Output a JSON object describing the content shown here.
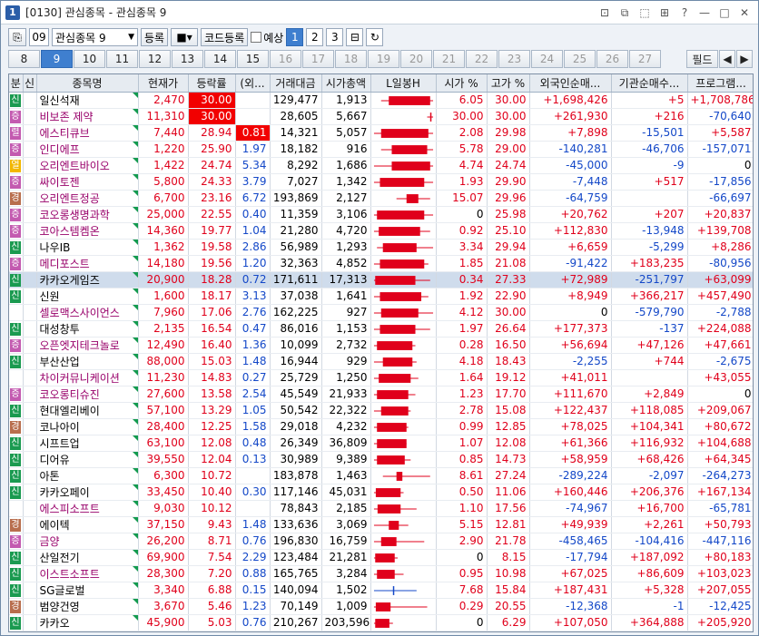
{
  "window": {
    "title": "[0130] 관심종목 - 관심종목 9"
  },
  "toolbar": {
    "group_no": "09",
    "group_name": "관심종목 9",
    "register": "등록",
    "code_register": "코드등록",
    "preview": "예상",
    "pages": [
      "1",
      "2",
      "3"
    ]
  },
  "tabs": [
    "8",
    "9",
    "10",
    "11",
    "12",
    "13",
    "14",
    "15",
    "16",
    "17",
    "18",
    "19",
    "20",
    "21",
    "22",
    "23",
    "24",
    "25",
    "26",
    "27"
  ],
  "active_tab": "9",
  "filter_label": "필드",
  "columns": [
    "분",
    "신",
    "종목명",
    "현재가",
    "등락률",
    "(외...",
    "거래대금",
    "시가총액",
    "L일봉H",
    "시가 %",
    "고가 %",
    "외국인순매...",
    "기관순매수...",
    "프로그램..."
  ],
  "colors": {
    "up": "#e0001b",
    "down": "#1448c8",
    "cat_sin": "#1a9a50",
    "cat_jeung": "#c35ab0",
    "cat_yeol": "#f2b700",
    "cat_gyeong": "#b86e4d",
    "highlight": "#f20000"
  },
  "rows": [
    {
      "cat": "신",
      "name": "일신석재",
      "price": "2,470",
      "rate": "30.00",
      "foreign": "",
      "amount": "129,477",
      "cap": "1,913",
      "open": "6.05",
      "high": "30.00",
      "fgn": "+1,698,426",
      "inst": "+5",
      "prog": "+1,708,786",
      "candle": {
        "lo": 0.12,
        "o": 0.25,
        "c": 0.95,
        "h": 1.0
      }
    },
    {
      "cat": "증",
      "name": "비보존 제약",
      "price": "11,310",
      "rate": "30.00",
      "foreign": "",
      "amount": "28,605",
      "cap": "5,667",
      "open": "30.00",
      "high": "30.00",
      "fgn": "+261,930",
      "inst": "+216",
      "prog": "-70,640",
      "candle": {
        "lo": 0.9,
        "o": 0.95,
        "c": 0.95,
        "h": 1.0
      }
    },
    {
      "cat": "렬",
      "name": "에스티큐브",
      "price": "7,440",
      "rate": "28.94",
      "foreign": "0.81",
      "amount": "14,321",
      "cap": "5,057",
      "open": "2.08",
      "high": "29.98",
      "fgn": "+7,898",
      "inst": "-15,501",
      "prog": "+5,587",
      "candle": {
        "lo": 0.0,
        "o": 0.12,
        "c": 0.92,
        "h": 1.0
      }
    },
    {
      "cat": "증",
      "name": "인디에프",
      "price": "1,220",
      "rate": "25.90",
      "foreign": "1.97",
      "amount": "18,182",
      "cap": "916",
      "open": "5.78",
      "high": "29.00",
      "fgn": "-140,281",
      "inst": "-46,706",
      "prog": "-157,071",
      "candle": {
        "lo": 0.12,
        "o": 0.3,
        "c": 0.9,
        "h": 1.0
      }
    },
    {
      "cat": "열",
      "name": "오리엔트바이오",
      "price": "1,422",
      "rate": "24.74",
      "foreign": "5.34",
      "amount": "8,292",
      "cap": "1,686",
      "open": "4.74",
      "high": "24.74",
      "fgn": "-45,000",
      "inst": "-9",
      "prog": "0",
      "candle": {
        "lo": 0.0,
        "o": 0.3,
        "c": 0.95,
        "h": 1.0
      }
    },
    {
      "cat": "증",
      "name": "싸이토젠",
      "price": "5,800",
      "rate": "24.33",
      "foreign": "3.79",
      "amount": "7,027",
      "cap": "1,342",
      "open": "1.93",
      "high": "29.90",
      "fgn": "-7,448",
      "inst": "+517",
      "prog": "-17,856",
      "candle": {
        "lo": 0.0,
        "o": 0.1,
        "c": 0.85,
        "h": 1.0
      }
    },
    {
      "cat": "경",
      "name": "오리엔트정공",
      "price": "6,700",
      "rate": "23.16",
      "foreign": "6.72",
      "amount": "193,869",
      "cap": "2,127",
      "open": "15.07",
      "high": "29.96",
      "fgn": "-64,759",
      "inst": "",
      "prog": "-66,697",
      "candle": {
        "lo": 0.38,
        "o": 0.55,
        "c": 0.75,
        "h": 0.95
      }
    },
    {
      "cat": "증",
      "name": "코오롱생명과학",
      "price": "25,000",
      "rate": "22.55",
      "foreign": "0.40",
      "amount": "11,359",
      "cap": "3,106",
      "open": "0",
      "high": "25.98",
      "fgn": "+20,762",
      "inst": "+207",
      "prog": "+20,837",
      "candle": {
        "lo": 0.0,
        "o": 0.05,
        "c": 0.85,
        "h": 1.0
      }
    },
    {
      "cat": "증",
      "name": "코아스템켐온",
      "price": "14,360",
      "rate": "19.77",
      "foreign": "1.04",
      "amount": "21,280",
      "cap": "4,720",
      "open": "0.92",
      "high": "25.10",
      "fgn": "+112,830",
      "inst": "-13,948",
      "prog": "+139,708",
      "candle": {
        "lo": 0.0,
        "o": 0.08,
        "c": 0.78,
        "h": 0.95
      }
    },
    {
      "cat": "신",
      "name": "나우IB",
      "price": "1,362",
      "rate": "19.58",
      "foreign": "2.86",
      "amount": "56,989",
      "cap": "1,293",
      "open": "3.34",
      "high": "29.94",
      "fgn": "+6,659",
      "inst": "-5,299",
      "prog": "+8,286",
      "candle": {
        "lo": 0.05,
        "o": 0.15,
        "c": 0.72,
        "h": 1.0
      }
    },
    {
      "cat": "증",
      "name": "메디포스트",
      "price": "14,180",
      "rate": "19.56",
      "foreign": "1.20",
      "amount": "32,363",
      "cap": "4,852",
      "open": "1.85",
      "high": "21.08",
      "fgn": "-91,422",
      "inst": "+183,235",
      "prog": "-80,956",
      "candle": {
        "lo": 0.0,
        "o": 0.1,
        "c": 0.85,
        "h": 0.92
      }
    },
    {
      "cat": "신",
      "name": "카카오게임즈",
      "price": "20,900",
      "rate": "18.28",
      "foreign": "0.72",
      "amount": "171,611",
      "cap": "17,313",
      "open": "0.34",
      "high": "27.33",
      "fgn": "+72,989",
      "inst": "-251,797",
      "prog": "+63,099",
      "candle": {
        "lo": 0.0,
        "o": 0.02,
        "c": 0.7,
        "h": 0.95
      },
      "selected": true
    },
    {
      "cat": "신",
      "name": "신원",
      "price": "1,600",
      "rate": "18.17",
      "foreign": "3.13",
      "amount": "37,038",
      "cap": "1,641",
      "open": "1.92",
      "high": "22.90",
      "fgn": "+8,949",
      "inst": "+366,217",
      "prog": "+457,490",
      "candle": {
        "lo": 0.0,
        "o": 0.1,
        "c": 0.8,
        "h": 0.92
      }
    },
    {
      "cat": "",
      "name": "셀로맥스사이언스",
      "price": "7,960",
      "rate": "17.06",
      "foreign": "2.76",
      "amount": "162,225",
      "cap": "927",
      "open": "4.12",
      "high": "30.00",
      "fgn": "0",
      "inst": "-579,790",
      "prog": "-2,788",
      "candle": {
        "lo": 0.0,
        "o": 0.12,
        "c": 0.75,
        "h": 1.0
      }
    },
    {
      "cat": "신",
      "name": "대성창투",
      "price": "2,135",
      "rate": "16.54",
      "foreign": "0.47",
      "amount": "86,016",
      "cap": "1,153",
      "open": "1.97",
      "high": "26.64",
      "fgn": "+177,373",
      "inst": "-137",
      "prog": "+224,088",
      "candle": {
        "lo": 0.0,
        "o": 0.1,
        "c": 0.7,
        "h": 0.95
      }
    },
    {
      "cat": "증",
      "name": "오픈엣지테크놀로",
      "price": "12,490",
      "rate": "16.40",
      "foreign": "1.36",
      "amount": "10,099",
      "cap": "2,732",
      "open": "0.28",
      "high": "16.50",
      "fgn": "+56,694",
      "inst": "+47,126",
      "prog": "+47,661",
      "candle": {
        "lo": 0.0,
        "o": 0.05,
        "c": 0.65,
        "h": 0.7
      }
    },
    {
      "cat": "신",
      "name": "부산산업",
      "price": "88,000",
      "rate": "15.03",
      "foreign": "1.48",
      "amount": "16,944",
      "cap": "929",
      "open": "4.18",
      "high": "18.43",
      "fgn": "-2,255",
      "inst": "+744",
      "prog": "-2,675",
      "candle": {
        "lo": 0.0,
        "o": 0.15,
        "c": 0.65,
        "h": 0.72
      }
    },
    {
      "cat": "",
      "name": "차이커뮤니케이션",
      "price": "11,230",
      "rate": "14.83",
      "foreign": "0.27",
      "amount": "25,729",
      "cap": "1,250",
      "open": "1.64",
      "high": "19.12",
      "fgn": "+41,011",
      "inst": "",
      "prog": "+43,055",
      "candle": {
        "lo": 0.0,
        "o": 0.08,
        "c": 0.62,
        "h": 0.75
      }
    },
    {
      "cat": "증",
      "name": "코오롱티슈진",
      "price": "27,600",
      "rate": "13.58",
      "foreign": "2.54",
      "amount": "45,549",
      "cap": "21,933",
      "open": "1.23",
      "high": "17.70",
      "fgn": "+111,670",
      "inst": "+2,849",
      "prog": "0",
      "candle": {
        "lo": 0.0,
        "o": 0.05,
        "c": 0.58,
        "h": 0.7
      }
    },
    {
      "cat": "신",
      "name": "현대엘리베이",
      "price": "57,100",
      "rate": "13.29",
      "foreign": "1.05",
      "amount": "50,542",
      "cap": "22,322",
      "open": "2.78",
      "high": "15.08",
      "fgn": "+122,437",
      "inst": "+118,085",
      "prog": "+209,067",
      "candle": {
        "lo": 0.0,
        "o": 0.12,
        "c": 0.58,
        "h": 0.62
      }
    },
    {
      "cat": "경",
      "name": "코나아이",
      "price": "28,400",
      "rate": "12.25",
      "foreign": "1.58",
      "amount": "29,018",
      "cap": "4,232",
      "open": "0.99",
      "high": "12.85",
      "fgn": "+78,025",
      "inst": "+104,341",
      "prog": "+80,672",
      "candle": {
        "lo": 0.0,
        "o": 0.05,
        "c": 0.55,
        "h": 0.58
      }
    },
    {
      "cat": "신",
      "name": "시프트업",
      "price": "63,100",
      "rate": "12.08",
      "foreign": "0.48",
      "amount": "26,349",
      "cap": "36,809",
      "open": "1.07",
      "high": "12.08",
      "fgn": "+61,366",
      "inst": "+116,932",
      "prog": "+104,688",
      "candle": {
        "lo": 0.0,
        "o": 0.05,
        "c": 0.55,
        "h": 0.55
      }
    },
    {
      "cat": "신",
      "name": "디어유",
      "price": "39,550",
      "rate": "12.04",
      "foreign": "0.13",
      "amount": "30,989",
      "cap": "9,389",
      "open": "0.85",
      "high": "14.73",
      "fgn": "+58,959",
      "inst": "+68,426",
      "prog": "+64,345",
      "candle": {
        "lo": 0.0,
        "o": 0.05,
        "c": 0.52,
        "h": 0.62
      }
    },
    {
      "cat": "신",
      "name": "아톤",
      "price": "6,300",
      "rate": "10.72",
      "foreign": "",
      "amount": "183,878",
      "cap": "1,463",
      "open": "8.61",
      "high": "27.24",
      "fgn": "-289,224",
      "inst": "-2,097",
      "prog": "-264,273",
      "candle": {
        "lo": 0.15,
        "o": 0.38,
        "c": 0.48,
        "h": 0.95
      }
    },
    {
      "cat": "신",
      "name": "카카오페이",
      "price": "33,450",
      "rate": "10.40",
      "foreign": "0.30",
      "amount": "117,146",
      "cap": "45,031",
      "open": "0.50",
      "high": "11.06",
      "fgn": "+160,446",
      "inst": "+206,376",
      "prog": "+167,134",
      "candle": {
        "lo": 0.0,
        "o": 0.03,
        "c": 0.45,
        "h": 0.5
      }
    },
    {
      "cat": "",
      "name": "에스피소프트",
      "price": "9,030",
      "rate": "10.12",
      "foreign": "",
      "amount": "78,843",
      "cap": "2,185",
      "open": "1.10",
      "high": "17.56",
      "fgn": "-74,967",
      "inst": "+16,700",
      "prog": "-65,781",
      "candle": {
        "lo": 0.0,
        "o": 0.06,
        "c": 0.45,
        "h": 0.72
      }
    },
    {
      "cat": "경",
      "name": "에이텍",
      "price": "37,150",
      "rate": "9.43",
      "foreign": "1.48",
      "amount": "133,636",
      "cap": "3,069",
      "open": "5.15",
      "high": "12.81",
      "fgn": "+49,939",
      "inst": "+2,261",
      "prog": "+50,793",
      "candle": {
        "lo": 0.0,
        "o": 0.25,
        "c": 0.42,
        "h": 0.58
      }
    },
    {
      "cat": "증",
      "name": "금양",
      "price": "26,200",
      "rate": "8.71",
      "foreign": "0.76",
      "amount": "196,830",
      "cap": "16,759",
      "open": "2.90",
      "high": "21.78",
      "fgn": "-458,465",
      "inst": "-104,416",
      "prog": "-447,116",
      "candle": {
        "lo": 0.0,
        "o": 0.12,
        "c": 0.38,
        "h": 0.85
      }
    },
    {
      "cat": "신",
      "name": "산일전기",
      "price": "69,900",
      "rate": "7.54",
      "foreign": "2.29",
      "amount": "123,484",
      "cap": "21,281",
      "open": "0",
      "high": "8.15",
      "fgn": "-17,794",
      "inst": "+187,092",
      "prog": "+80,183",
      "candle": {
        "lo": 0.0,
        "o": 0.02,
        "c": 0.35,
        "h": 0.4
      }
    },
    {
      "cat": "신",
      "name": "이스트소프트",
      "price": "28,300",
      "rate": "7.20",
      "foreign": "0.88",
      "amount": "165,765",
      "cap": "3,284",
      "open": "0.95",
      "high": "10.98",
      "fgn": "+67,025",
      "inst": "+86,609",
      "prog": "+103,023",
      "candle": {
        "lo": 0.0,
        "o": 0.05,
        "c": 0.35,
        "h": 0.5
      }
    },
    {
      "cat": "신",
      "name": "SG글로벌",
      "price": "3,340",
      "rate": "6.88",
      "foreign": "0.15",
      "amount": "140,094",
      "cap": "1,502",
      "open": "7.68",
      "high": "15.84",
      "fgn": "+187,431",
      "inst": "+5,328",
      "prog": "+207,055",
      "candle": {
        "lo": 0.0,
        "o": 0.34,
        "c": 0.32,
        "h": 0.72
      }
    },
    {
      "cat": "경",
      "name": "범양건영",
      "price": "3,670",
      "rate": "5.46",
      "foreign": "1.23",
      "amount": "70,149",
      "cap": "1,009",
      "open": "0.29",
      "high": "20.55",
      "fgn": "-12,368",
      "inst": "-1",
      "prog": "-12,425",
      "candle": {
        "lo": 0.0,
        "o": 0.03,
        "c": 0.28,
        "h": 0.9
      }
    },
    {
      "cat": "신",
      "name": "카카오",
      "price": "45,900",
      "rate": "5.03",
      "foreign": "0.76",
      "amount": "210,267",
      "cap": "203,596",
      "open": "0",
      "high": "6.29",
      "fgn": "+107,050",
      "inst": "+364,888",
      "prog": "+205,920",
      "candle": {
        "lo": 0.0,
        "o": 0.02,
        "c": 0.26,
        "h": 0.32
      }
    }
  ]
}
